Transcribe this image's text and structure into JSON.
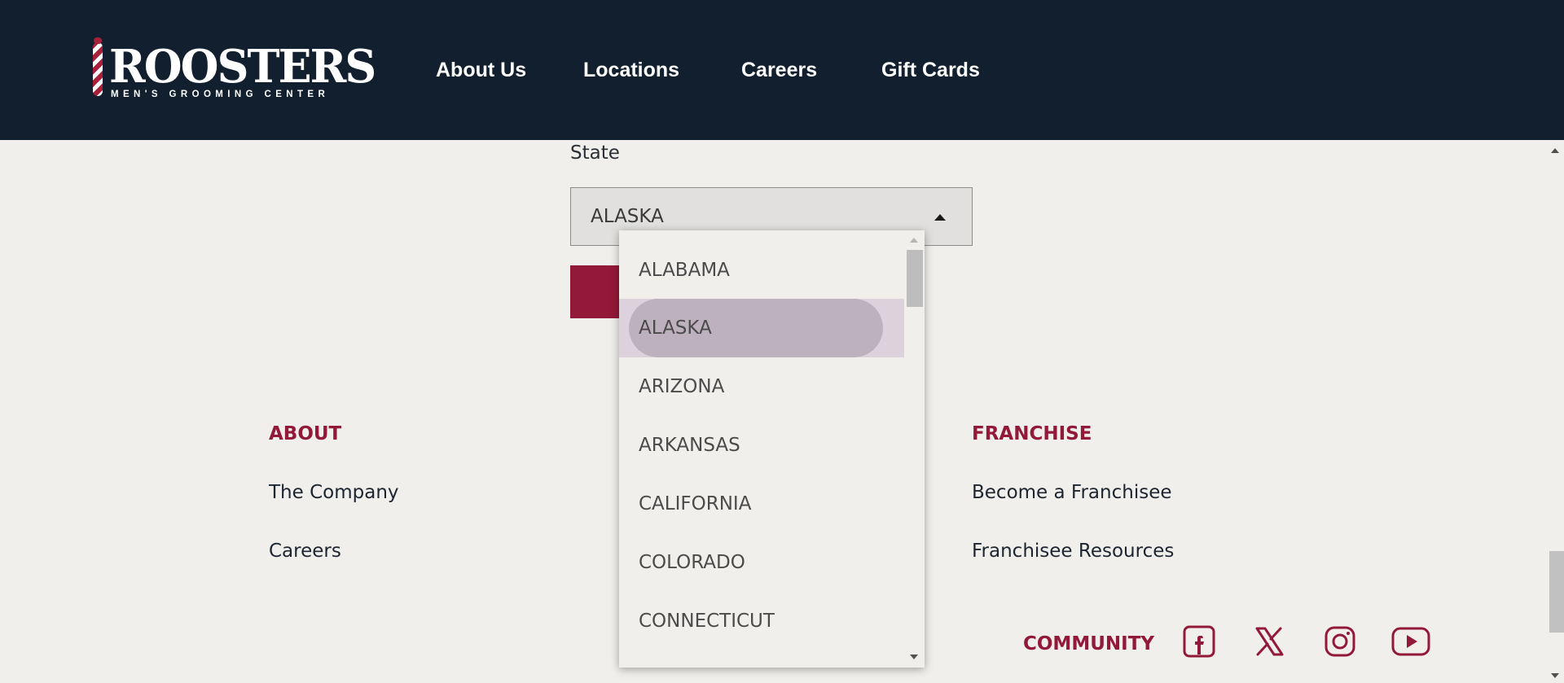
{
  "header": {
    "logo": {
      "name": "ROOSTERS",
      "tagline": "MEN'S GROOMING CENTER"
    },
    "nav": [
      "About Us",
      "Locations",
      "Careers",
      "Gift Cards"
    ]
  },
  "form": {
    "state_label": "State",
    "state_value": "ALASKA"
  },
  "dropdown": {
    "options": [
      "ALABAMA",
      "ALASKA",
      "ARIZONA",
      "ARKANSAS",
      "CALIFORNIA",
      "COLORADO",
      "CONNECTICUT"
    ],
    "selected": "ALASKA"
  },
  "footer": {
    "about": {
      "heading": "ABOUT",
      "links": [
        "The Company",
        "Careers"
      ]
    },
    "franchise": {
      "heading": "FRANCHISE",
      "links": [
        "Become a Franchisee",
        "Franchisee Resources"
      ]
    },
    "community": {
      "heading": "COMMUNITY",
      "icons": [
        "facebook-icon",
        "x-icon",
        "instagram-icon",
        "youtube-icon"
      ]
    }
  },
  "colors": {
    "header_bg": "#111f2e",
    "accent": "#931938",
    "page_bg": "#f0efec"
  }
}
